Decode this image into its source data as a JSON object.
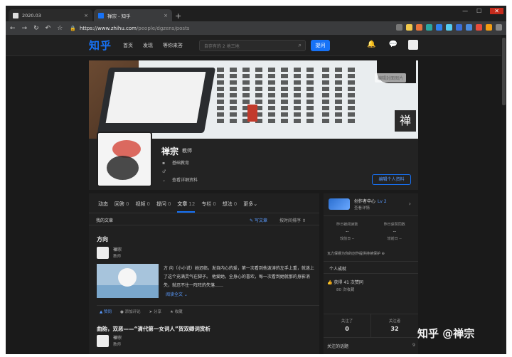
{
  "browser": {
    "tabs": [
      {
        "title": "2020.03"
      },
      {
        "title": "禅宗 - 知乎"
      }
    ],
    "url_base": "https://www.zhihu.com",
    "url_path": "/people/dgzens/posts"
  },
  "zhihu": {
    "logo": "知乎",
    "nav": [
      "首页",
      "发现",
      "等你来答"
    ],
    "search_placeholder": "自存有的 2 地三地",
    "ask_button": "提问"
  },
  "banner": {
    "edit_cover": "编辑封面图片",
    "seal_char": "禅"
  },
  "profile": {
    "name": "禅宗",
    "headline": "教师",
    "field": "基础教育",
    "gender_icon": "♂",
    "details": "查看详细资料",
    "edit_button": "编辑个人资料"
  },
  "tabs": [
    {
      "label": "动态",
      "count": ""
    },
    {
      "label": "回答",
      "count": "0"
    },
    {
      "label": "视频",
      "count": "0"
    },
    {
      "label": "提问",
      "count": "0"
    },
    {
      "label": "文章",
      "count": "12"
    },
    {
      "label": "专栏",
      "count": "0"
    },
    {
      "label": "想法",
      "count": "0"
    },
    {
      "label": "更多",
      "count": ""
    }
  ],
  "section": {
    "title": "我的文章",
    "write": "写文章",
    "sort": "按时间排序"
  },
  "article1": {
    "title": "方向",
    "author": "禅宗",
    "author_desc": "教师",
    "excerpt": "方 向（小小说）她迟临，发自内心的爱，第一次看到他波涛的左手上重，就迷上了这个充满灵气在脚子。 他爱她，全身心的喜欢，每一次看到她就那的身影消失，就忍不住一阵阵的失落……",
    "read_more": "阅读全文",
    "actions": [
      "赞同",
      "添加评论",
      "分享",
      "收藏"
    ]
  },
  "article2": {
    "title": "曲韵，双恶——“清代第一女词人”贺双卿词赏析",
    "author": "禅宗",
    "author_desc": "教师"
  },
  "sidebar": {
    "creator_center": "创作者中心",
    "level": "Lv 2",
    "creator_sub": "查看详情",
    "stats": [
      {
        "label": "昨日被阅读数",
        "value": "--",
        "sub": "较前日 --"
      },
      {
        "label": "昨日获赞同数",
        "value": "--",
        "sub": "较前日 --"
      }
    ],
    "tip": "瓦力保镖为你的创作提供持续保护",
    "achievement_title": "个人成就",
    "achievements": [
      "获得 41 次赞同",
      "80 次收藏"
    ],
    "following_label": "关注了",
    "following": "0",
    "followers_label": "关注者",
    "followers": "32",
    "topic_label": "关注的话题",
    "topic_count": "9"
  },
  "watermark": "知乎 @禅宗"
}
